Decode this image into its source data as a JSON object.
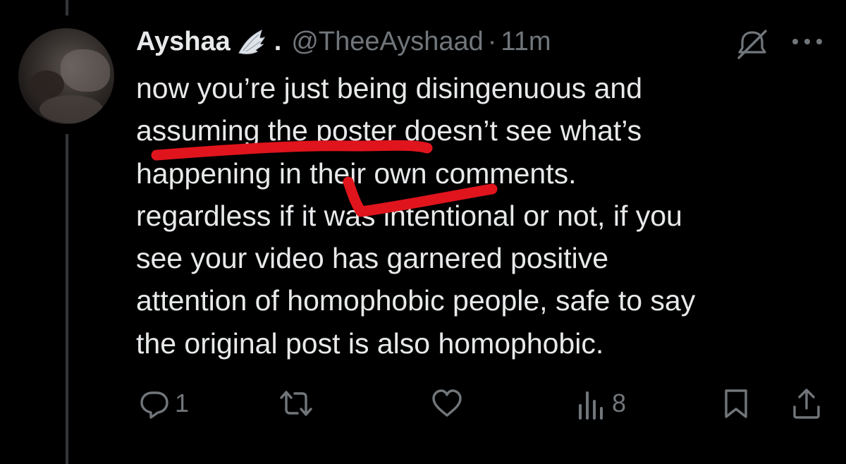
{
  "tweet": {
    "display_name": "Ayshaa",
    "name_suffix": ".",
    "handle": "@TheeAyshaad",
    "separator": "·",
    "timestamp": "11m",
    "text_lines": [
      "now you’re just being disingenuous and",
      "assuming the poster doesn’t see what’s",
      "happening in their own comments.",
      "regardless if it was intentional or not, if you",
      "see your video has garnered positive",
      "attention of homophobic people, safe to say",
      "the original post is also homophobic."
    ]
  },
  "icons": {
    "badge": "angel-wing-icon",
    "mute": "mute-conversation-icon",
    "more": "more-options-icon"
  },
  "actions": {
    "reply_count": "1",
    "retweet_count": "",
    "like_count": "",
    "views_count": "8"
  },
  "colors": {
    "background": "#000000",
    "primary_text": "#e7e9ea",
    "secondary_text": "#71767b",
    "thread_line": "#333639",
    "annotation_red": "#e0141c"
  }
}
